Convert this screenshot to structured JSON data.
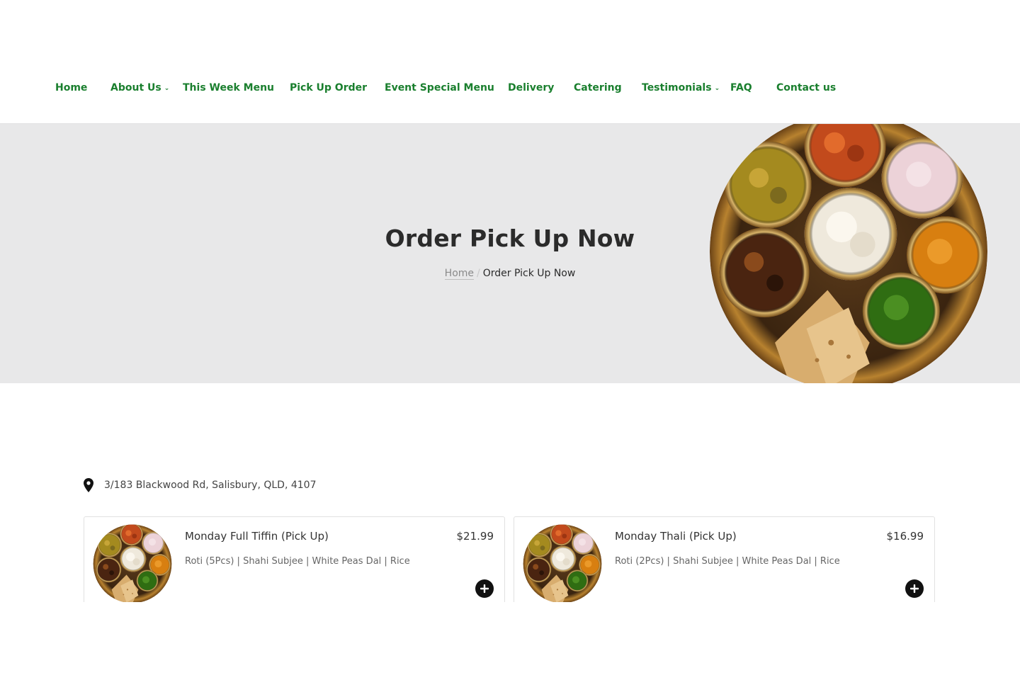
{
  "nav": {
    "items": [
      {
        "label": "Home",
        "has_dropdown": false
      },
      {
        "label": "About Us",
        "has_dropdown": true
      },
      {
        "label": "This Week Menu",
        "has_dropdown": false
      },
      {
        "label": "Pick Up Order",
        "has_dropdown": false
      },
      {
        "label": "Event Special Menu",
        "has_dropdown": false
      },
      {
        "label": "Delivery",
        "has_dropdown": false
      },
      {
        "label": "Catering",
        "has_dropdown": false
      },
      {
        "label": "Testimonials",
        "has_dropdown": true
      },
      {
        "label": "FAQ",
        "has_dropdown": false
      },
      {
        "label": "Contact us",
        "has_dropdown": false
      }
    ],
    "dropdown_icon": "chevron-down-icon"
  },
  "hero": {
    "title": "Order Pick Up Now",
    "breadcrumb": {
      "home": "Home",
      "separator": "/",
      "current": "Order Pick Up Now"
    },
    "image": "thali-plate-image"
  },
  "location": {
    "icon": "map-pin-icon",
    "address": "3/183 Blackwood Rd, Salisbury, QLD, 4107"
  },
  "products": [
    {
      "title": "Monday Full Tiffin (Pick Up)",
      "price": "$21.99",
      "description": "Roti (5Pcs) | Shahi Subjee | White Peas Dal | Rice",
      "image": "thali-thumbnail",
      "add_icon": "plus-circle-icon"
    },
    {
      "title": "Monday Thali (Pick Up)",
      "price": "$16.99",
      "description": "Roti (2Pcs) | Shahi Subjee | White Peas Dal | Rice",
      "image": "thali-thumbnail",
      "add_icon": "plus-circle-icon"
    }
  ],
  "colors": {
    "nav_link": "#1a7f2e",
    "hero_bg": "#e8e8e9",
    "title_text": "#2b2b2b",
    "add_button": "#111111"
  }
}
